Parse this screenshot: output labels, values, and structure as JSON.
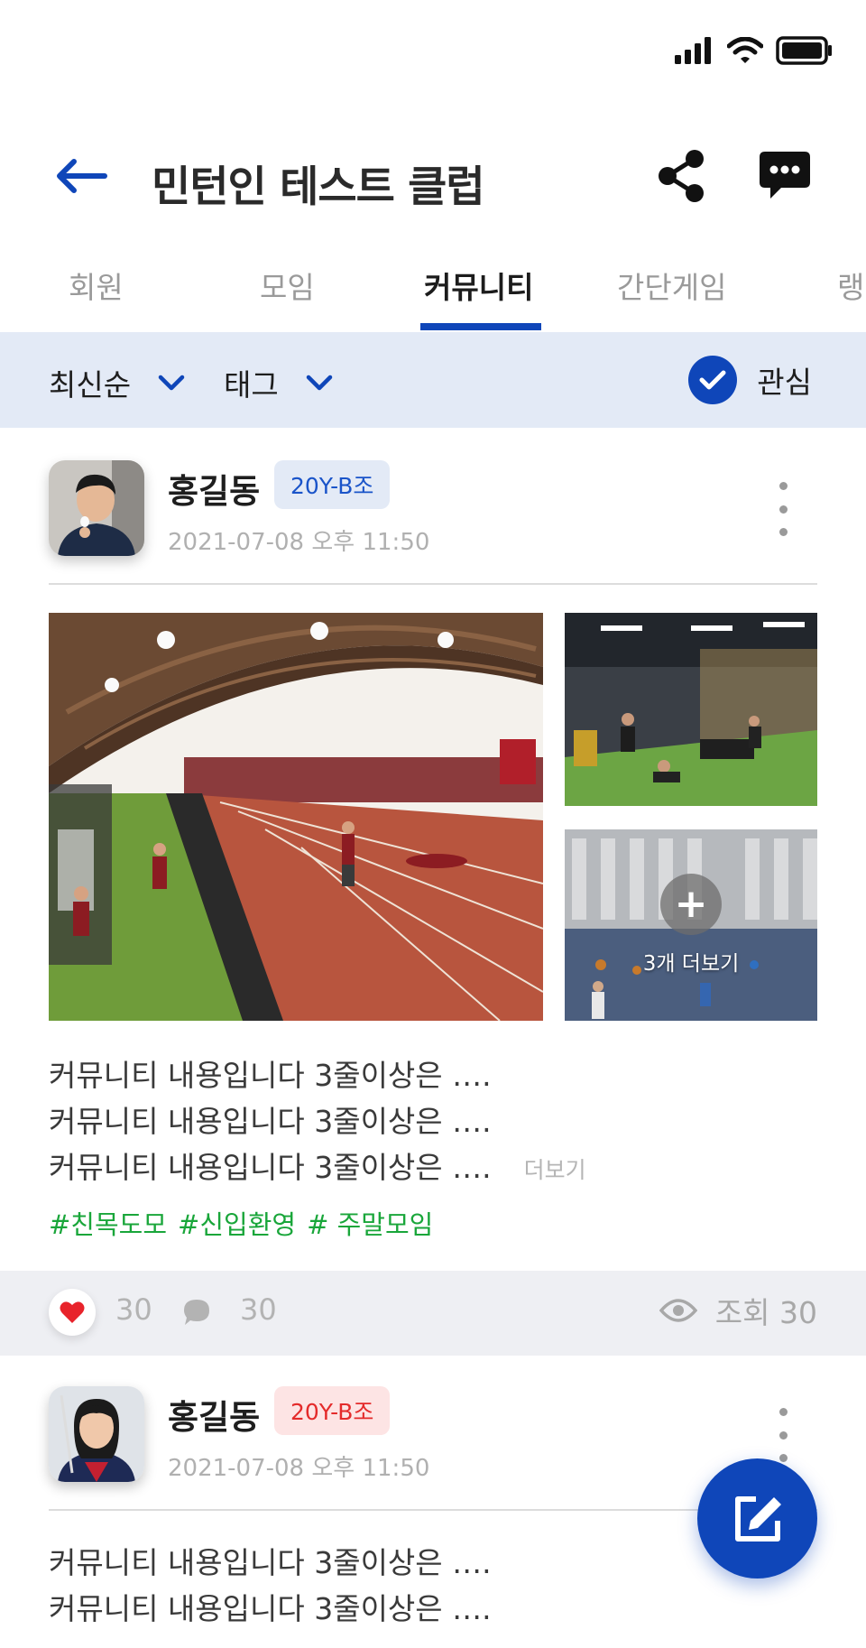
{
  "header": {
    "title": "민턴인 테스트 클럽"
  },
  "tabs": [
    "회원",
    "모임",
    "커뮤니티",
    "간단게임",
    "랭"
  ],
  "active_tab": "커뮤니티",
  "filters": {
    "sort_label": "최신순",
    "tag_label": "태그",
    "interest_label": "관심"
  },
  "posts": [
    {
      "author": "홍길동",
      "badge": "20Y-B조",
      "badge_color": "#1a54c9",
      "date": "2021-07-08 오후 11:50",
      "more_photos_label": "3개 더보기",
      "lines": [
        "커뮤니티 내용입니다 3줄이상은 ….",
        "커뮤니티 내용입니다 3줄이상은 ….",
        "커뮤니티 내용입니다 3줄이상은 …."
      ],
      "read_more": "더보기",
      "tags": [
        "#친목도모",
        "#신입환영",
        "# 주말모임"
      ],
      "likes": "30",
      "comments": "30",
      "views": "조회 30"
    },
    {
      "author": "홍길동",
      "badge": "20Y-B조",
      "badge_color": "#e42b2b",
      "date": "2021-07-08 오후 11:50",
      "lines": [
        "커뮤니티 내용입니다 3줄이상은 ….",
        "커뮤니티 내용입니다 3줄이상은 …."
      ]
    }
  ],
  "colors": {
    "primary": "#0f46b9",
    "filter_bg": "#e3eaf6",
    "tag_green": "#19a63a",
    "like_red": "#e8232b"
  }
}
